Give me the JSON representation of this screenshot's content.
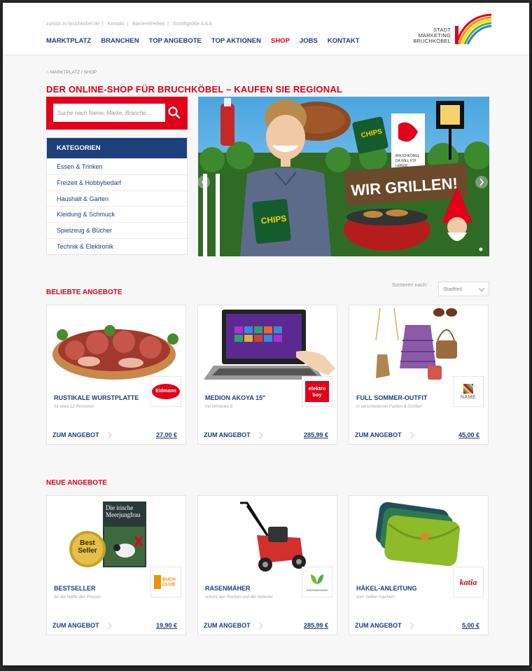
{
  "topbar": {
    "back_link": "zurück zu bruchköbel.de",
    "contact": "Kontakt",
    "accessibility": "Barrierefreiheit",
    "fontsize": "Schriftgröße A A A"
  },
  "nav": {
    "items": [
      "MARKTPLATZ",
      "BRANCHEN",
      "TOP ANGEBOTE",
      "TOP AKTIONEN",
      "SHOP",
      "JOBS",
      "KONTAKT"
    ],
    "active": "SHOP"
  },
  "logo": {
    "line1": "STADT",
    "line2": "MARKETING",
    "line3": "BRUCHKÖBEL"
  },
  "breadcrumb": {
    "home": "MARKTPLATZ",
    "sep": "/",
    "current": "SHOP"
  },
  "page_title": "DER ONLINE-SHOP FÜR BRUCHKÖBEL – KAUFEN SIE REGIONAL",
  "search": {
    "placeholder": "Suche nach Name, Marke, Branche..."
  },
  "categories": {
    "header": "KATEGORIEN",
    "items": [
      "Essen & Trinken",
      "Freizeit & Hobbybedarf",
      "Haushalt & Garten",
      "Kleidung & Schmuck",
      "Spielzeug & Bücher",
      "Technik & Elektronik"
    ]
  },
  "banner": {
    "headline": "WIR GRILLEN!",
    "chips_label": "CHIPS",
    "badge_text": "BRUCHKÖBEL DA WILL ICH LEBEN!"
  },
  "popular": {
    "title": "BELIEBTE ANGEBOTE",
    "sort_label": "Sortieren nach:",
    "sort_value": "Stadtteil",
    "cards": [
      {
        "title": "RUSTIKALE WURSTPLATTE",
        "subtitle": "für etwa 12 Personen",
        "cta": "ZUM ANGEBOT",
        "price": "27,00 €",
        "brand": "Eidmann"
      },
      {
        "title": "MEDION AKOYA 15\"",
        "subtitle": "mit Windows 8",
        "cta": "ZUM ANGEBOT",
        "price": "285,99 €",
        "brand": "elektro boy"
      },
      {
        "title": "FULL SOMMER-OUTFIT",
        "subtitle": "in verschiedenen Farben & Größen",
        "cta": "ZUM ANGEBOT",
        "price": "45,00 €",
        "brand": "NAME"
      }
    ]
  },
  "new": {
    "title": "NEUE ANGEBOTE",
    "cards": [
      {
        "title": "BESTSELLER",
        "subtitle": "für die Hälfte des Preises",
        "cta": "ZUM ANGEBOT",
        "price": "19,90 €",
        "brand": "BUCH CLUB",
        "book_title": "Die irische Meerjungfrau",
        "seal": "Best Seller"
      },
      {
        "title": "RASENMÄHER",
        "subtitle": "schont den Rücken und  die Gelenke",
        "cta": "ZUM ANGEBOT",
        "price": "285,99 €",
        "brand": "GARTENWONNES"
      },
      {
        "title": "HÄKEL-ANLEITUNG",
        "subtitle": "zum Selber machen!",
        "cta": "ZUM ANGEBOT",
        "price": "5,00 €",
        "brand": "katia"
      }
    ]
  },
  "colors": {
    "red": "#e2001a",
    "navy": "#1d3f7a"
  }
}
